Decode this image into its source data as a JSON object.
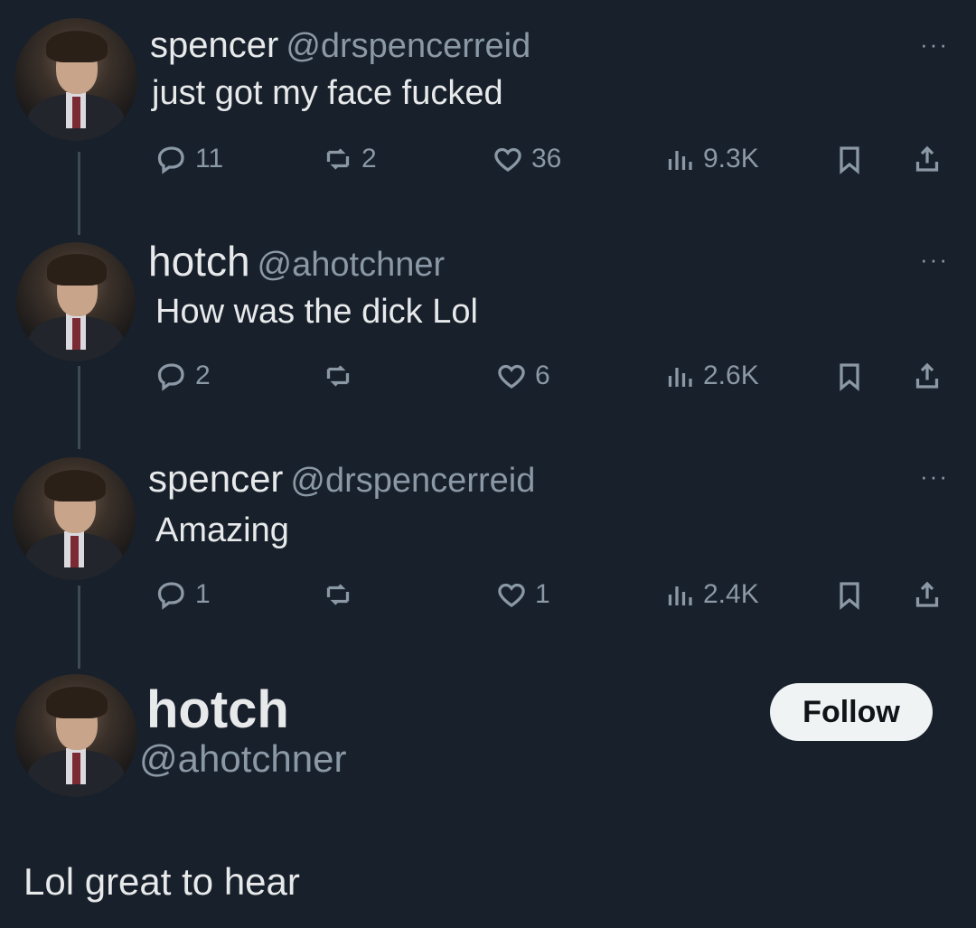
{
  "tweets": [
    {
      "name": "spencer",
      "handle": "@drspencerreid",
      "text": "just got my face fucked",
      "replies": "11",
      "retweets": "2",
      "likes": "36",
      "views": "9.3K"
    },
    {
      "name": "hotch",
      "handle": "@ahotchner",
      "text": "How was the dick Lol",
      "replies": "2",
      "retweets": "",
      "likes": "6",
      "views": "2.6K"
    },
    {
      "name": "spencer",
      "handle": "@drspencerreid",
      "text": "Amazing",
      "replies": "1",
      "retweets": "",
      "likes": "1",
      "views": "2.4K"
    }
  ],
  "main_tweet": {
    "name": "hotch",
    "handle": "@ahotchner",
    "follow_label": "Follow",
    "text": "Lol great to hear"
  },
  "more_icon": "···",
  "colors": {
    "background": "#17202b",
    "text": "#e7e9ea",
    "muted": "#8b98a5",
    "thread_line": "#3f4a57",
    "follow_bg": "#eff3f4"
  }
}
